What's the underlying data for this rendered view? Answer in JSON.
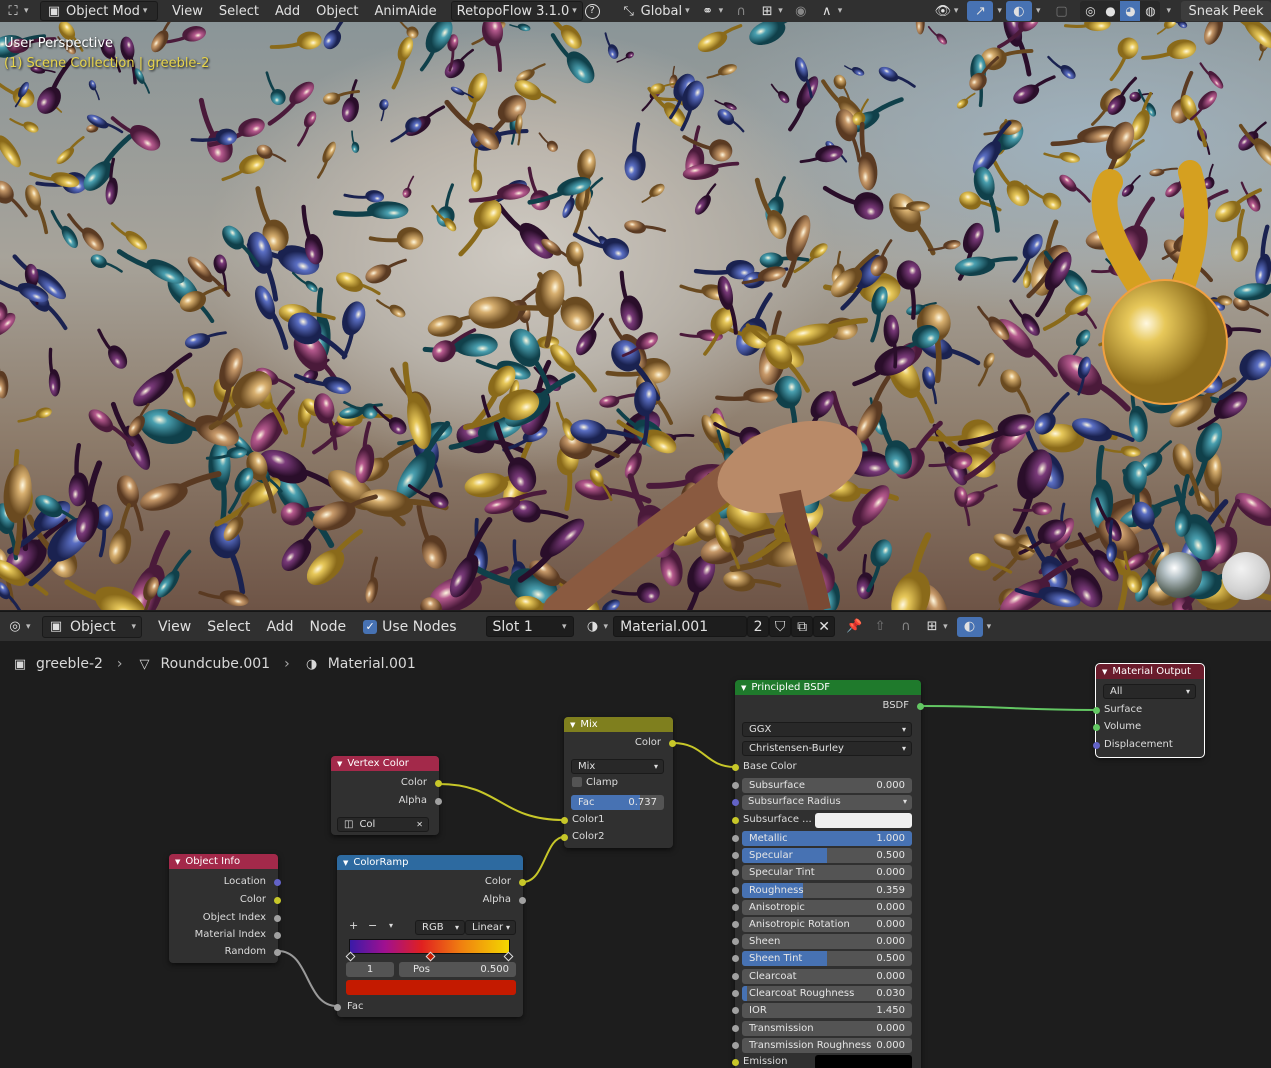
{
  "top_header": {
    "mode": "Object Mod",
    "menus": [
      "View",
      "Select",
      "Add",
      "Object",
      "AnimAide"
    ],
    "addon": "RetopoFlow 3.1.0",
    "orientation": "Global",
    "sneak_peek": "Sneak Peek"
  },
  "viewport": {
    "title": "User Perspective",
    "collection": "(1) Scene Collection | greeble-2"
  },
  "node_header": {
    "type": "Object",
    "menus": [
      "View",
      "Select",
      "Add",
      "Node"
    ],
    "use_nodes": "Use Nodes",
    "slot": "Slot 1",
    "material": "Material.001",
    "users": "2"
  },
  "breadcrumb": {
    "object": "greeble-2",
    "mesh": "Roundcube.001",
    "material": "Material.001"
  },
  "nodes": {
    "object_info": {
      "title": "Object Info",
      "outputs": [
        "Location",
        "Color",
        "Object Index",
        "Material Index",
        "Random"
      ]
    },
    "vertex_color": {
      "title": "Vertex Color",
      "outputs": [
        "Color",
        "Alpha"
      ],
      "layer": "Col"
    },
    "color_ramp": {
      "title": "ColorRamp",
      "outputs": [
        "Color",
        "Alpha"
      ],
      "plus": "+",
      "minus": "−",
      "mode": "RGB",
      "interpolation": "Linear",
      "index": "1",
      "pos_label": "Pos",
      "pos_value": "0.500",
      "input": "Fac",
      "stop_color": "#c41a00"
    },
    "mix": {
      "title": "Mix",
      "output": "Color",
      "blend": "Mix",
      "clamp": "Clamp",
      "fac_label": "Fac",
      "fac_value": "0.737",
      "fac": 0.737,
      "inputs": [
        "Color1",
        "Color2"
      ]
    },
    "principled": {
      "title": "Principled BSDF",
      "output": "BSDF",
      "distribution": "GGX",
      "subsurface_method": "Christensen-Burley",
      "base_color": "Base Color",
      "subsurface_radius": "Subsurface Radius",
      "subsurface_color": "Subsurface ...",
      "emission": "Emission",
      "params": [
        {
          "label": "Subsurface",
          "value": "0.000",
          "fill": 0
        },
        {
          "label": "Metallic",
          "value": "1.000",
          "fill": 1
        },
        {
          "label": "Specular",
          "value": "0.500",
          "fill": 0.5
        },
        {
          "label": "Specular Tint",
          "value": "0.000",
          "fill": 0
        },
        {
          "label": "Roughness",
          "value": "0.359",
          "fill": 0.359
        },
        {
          "label": "Anisotropic",
          "value": "0.000",
          "fill": 0
        },
        {
          "label": "Anisotropic Rotation",
          "value": "0.000",
          "fill": 0
        },
        {
          "label": "Sheen",
          "value": "0.000",
          "fill": 0
        },
        {
          "label": "Sheen Tint",
          "value": "0.500",
          "fill": 0.5
        },
        {
          "label": "Clearcoat",
          "value": "0.000",
          "fill": 0
        },
        {
          "label": "Clearcoat Roughness",
          "value": "0.030",
          "fill": 0.03
        },
        {
          "label": "IOR",
          "value": "1.450",
          "fill": 0
        }
      ],
      "tail_params": [
        {
          "label": "Transmission",
          "value": "0.000",
          "fill": 0
        },
        {
          "label": "Transmission Roughness",
          "value": "0.000",
          "fill": 0
        }
      ]
    },
    "material_output": {
      "title": "Material Output",
      "target": "All",
      "inputs": [
        "Surface",
        "Volume",
        "Displacement"
      ]
    }
  },
  "colors": {
    "accent": "#4772b3",
    "header_color_node": "#a3294a",
    "header_converter": "#2d6aa0",
    "header_mix": "#7f7f1e",
    "header_shader": "#1f7a2c",
    "header_output": "#6a1c2c"
  }
}
